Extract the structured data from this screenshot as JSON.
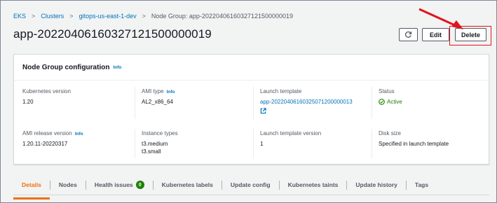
{
  "breadcrumb": {
    "items": [
      "EKS",
      "Clusters",
      "gitops-us-east-1-dev"
    ],
    "current": "Node Group: app-20220406160327121500000019",
    "separator": ">"
  },
  "page": {
    "title": "app-20220406160327121500000019"
  },
  "actions": {
    "edit_label": "Edit",
    "delete_label": "Delete"
  },
  "card": {
    "title": "Node Group configuration",
    "info_label": "Info",
    "fields": {
      "kubernetes_version": {
        "label": "Kubernetes version",
        "value": "1.20"
      },
      "ami_type": {
        "label": "AMI type",
        "info": "Info",
        "value": "AL2_x86_64"
      },
      "launch_template": {
        "label": "Launch template",
        "value": "app-20220406160325071200000013"
      },
      "status": {
        "label": "Status",
        "value": "Active"
      },
      "ami_release_version": {
        "label": "AMI release version",
        "info": "Info",
        "value": "1.20.11-20220317"
      },
      "instance_types": {
        "label": "Instance types",
        "values": [
          "t3.medium",
          "t3.small"
        ]
      },
      "launch_template_version": {
        "label": "Launch template version",
        "value": "1"
      },
      "disk_size": {
        "label": "Disk size",
        "value": "Specified in launch template"
      }
    }
  },
  "tabs": [
    {
      "label": "Details",
      "active": true
    },
    {
      "label": "Nodes"
    },
    {
      "label": "Health issues",
      "badge": "0"
    },
    {
      "label": "Kubernetes labels"
    },
    {
      "label": "Update config"
    },
    {
      "label": "Kubernetes taints"
    },
    {
      "label": "Update history"
    },
    {
      "label": "Tags"
    }
  ],
  "colors": {
    "link": "#0073bb",
    "active_tab": "#ec7211",
    "status_ok": "#1d8102",
    "annotation": "#e0141e"
  },
  "icons": {
    "refresh": "refresh-icon",
    "external_link": "external-link-icon",
    "status": "check-circle-icon"
  }
}
